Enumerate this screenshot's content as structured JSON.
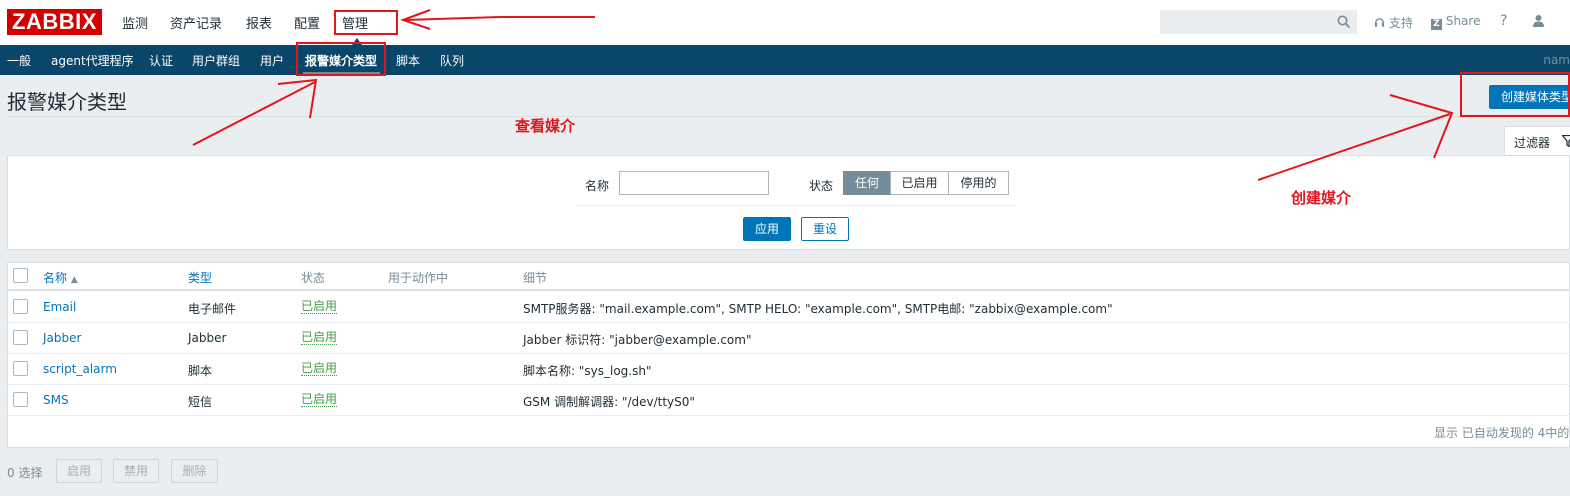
{
  "header": {
    "logo": "ZABBIX",
    "nav": [
      "监测",
      "资产记录",
      "报表",
      "配置",
      "管理"
    ],
    "support": "支持",
    "share": "Share",
    "help": "?"
  },
  "subnav": {
    "items": [
      "一般",
      "agent代理程序",
      "认证",
      "用户群组",
      "用户",
      "报警媒介类型",
      "脚本",
      "队列"
    ],
    "right_text": "nam"
  },
  "page": {
    "title": "报警媒介类型",
    "create_button": "创建媒体类型",
    "filter_tab": "过滤器"
  },
  "filter": {
    "name_label": "名称",
    "name_value": "",
    "status_label": "状态",
    "status_options": [
      "任何",
      "已启用",
      "停用的"
    ],
    "status_selected": "任何",
    "apply": "应用",
    "reset": "重设"
  },
  "table": {
    "columns": [
      "名称",
      "类型",
      "状态",
      "用于动作中",
      "细节"
    ],
    "sort_arrow": "▲",
    "rows": [
      {
        "name": "Email",
        "type": "电子邮件",
        "status": "已启用",
        "used_in": "",
        "details": "SMTP服务器: \"mail.example.com\", SMTP HELO: \"example.com\", SMTP电邮: \"zabbix@example.com\""
      },
      {
        "name": "Jabber",
        "type": "Jabber",
        "status": "已启用",
        "used_in": "",
        "details": "Jabber 标识符: \"jabber@example.com\""
      },
      {
        "name": "script_alarm",
        "type": "脚本",
        "status": "已启用",
        "used_in": "",
        "details": "脚本名称: \"sys_log.sh\""
      },
      {
        "name": "SMS",
        "type": "短信",
        "status": "已启用",
        "used_in": "",
        "details": "GSM 调制解调器: \"/dev/ttyS0\""
      }
    ],
    "footer": "显示 已自动发现的 4中的"
  },
  "bottom": {
    "selected": "0 选择",
    "buttons": [
      "启用",
      "禁用",
      "删除"
    ]
  },
  "annotations": {
    "view_media": "查看媒介",
    "create_media": "创建媒介",
    "color": "#e3151e"
  },
  "colors": {
    "brand": "#d40000",
    "subnav_bg": "#0a466a",
    "primary": "#0275b8",
    "enabled": "#429e47"
  }
}
